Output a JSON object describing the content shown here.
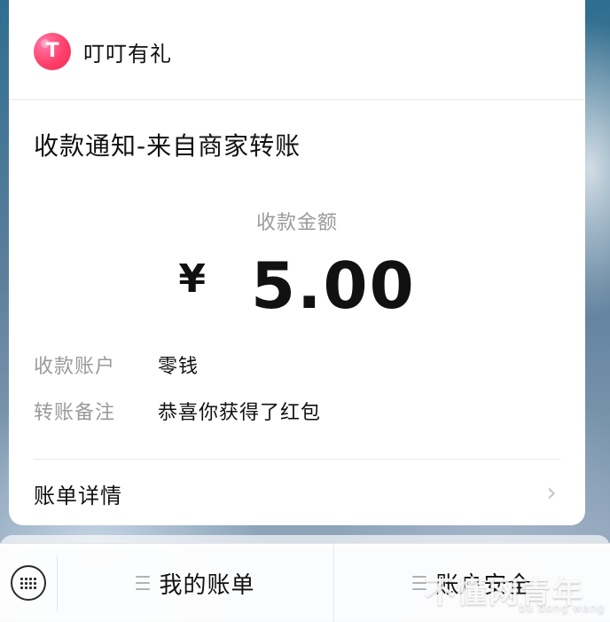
{
  "sender": {
    "name": "叮叮有礼"
  },
  "notice": {
    "title": "收款通知-来自商家转账",
    "amount_label": "收款金额",
    "currency_symbol": "¥",
    "amount": "5.00",
    "fields": [
      {
        "label": "收款账户",
        "value": "零钱"
      },
      {
        "label": "转账备注",
        "value": "恭喜你获得了红包"
      }
    ],
    "bill_details_label": "账单详情"
  },
  "bottom_menu": {
    "items": [
      {
        "label": "我的账单"
      },
      {
        "label": "账户安全"
      }
    ]
  },
  "watermark": {
    "main": "不懂网青年",
    "sub": "bu dong wang"
  }
}
